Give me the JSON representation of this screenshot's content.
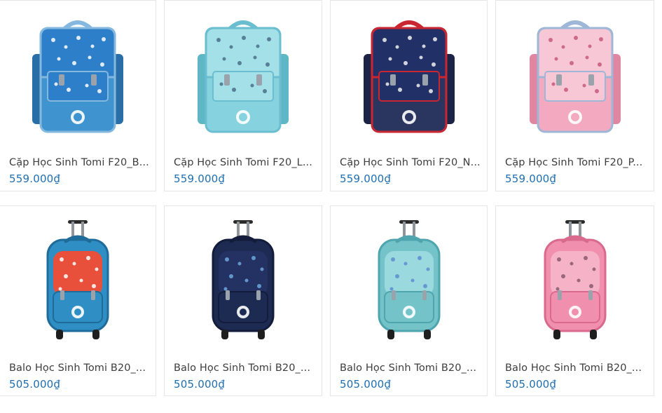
{
  "products": [
    {
      "name": "Cặp Học Sinh Tomi F20_B...",
      "price": "559.000₫",
      "icon": "school-bag-icon",
      "colors": {
        "body": "#3f93cf",
        "dark": "#2a6ea8",
        "flap": "#2d7fc9",
        "pattern": "#ffffff",
        "trim": "#84b8de"
      }
    },
    {
      "name": "Cặp Học Sinh Tomi F20_L...",
      "price": "559.000₫",
      "icon": "school-bag-icon",
      "colors": {
        "body": "#86d3df",
        "dark": "#5fb7c6",
        "flap": "#a3e0e8",
        "pattern": "#4a6f88",
        "trim": "#6bbed0"
      }
    },
    {
      "name": "Cặp Học Sinh Tomi F20_N...",
      "price": "559.000₫",
      "icon": "school-bag-icon",
      "colors": {
        "body": "#2a3560",
        "dark": "#1b2347",
        "flap": "#223068",
        "pattern": "#f0f0f0",
        "trim": "#c92631"
      }
    },
    {
      "name": "Cặp Học Sinh Tomi F20_P...",
      "price": "559.000₫",
      "icon": "school-bag-icon",
      "colors": {
        "body": "#f3a9c0",
        "dark": "#e086a3",
        "flap": "#f8c7d6",
        "pattern": "#c75a7c",
        "trim": "#9fb7d6"
      }
    },
    {
      "name": "Balo Học Sinh Tomi B20_...",
      "price": "505.000₫",
      "icon": "trolley-backpack-icon",
      "colors": {
        "body": "#2f8fc4",
        "dark": "#1f6c9a",
        "flap": "#e8503b",
        "pattern": "#ffffff",
        "trim": "#1f6c9a"
      }
    },
    {
      "name": "Balo Học Sinh Tomi B20_...",
      "price": "505.000₫",
      "icon": "trolley-backpack-icon",
      "colors": {
        "body": "#1d2a52",
        "dark": "#131c3a",
        "flap": "#233263",
        "pattern": "#6fa7e0",
        "trim": "#131c3a"
      }
    },
    {
      "name": "Balo Học Sinh Tomi B20_...",
      "price": "505.000₫",
      "icon": "trolley-backpack-icon",
      "colors": {
        "body": "#74c3c9",
        "dark": "#4fa5ae",
        "flap": "#9ad9dd",
        "pattern": "#5d8fd0",
        "trim": "#4fa5ae"
      }
    },
    {
      "name": "Balo Học Sinh Tomi B20_...",
      "price": "505.000₫",
      "icon": "trolley-backpack-icon",
      "colors": {
        "body": "#f08fae",
        "dark": "#d96a8e",
        "flap": "#f6b3c7",
        "pattern": "#8a5a6e",
        "trim": "#d96a8e"
      }
    }
  ]
}
